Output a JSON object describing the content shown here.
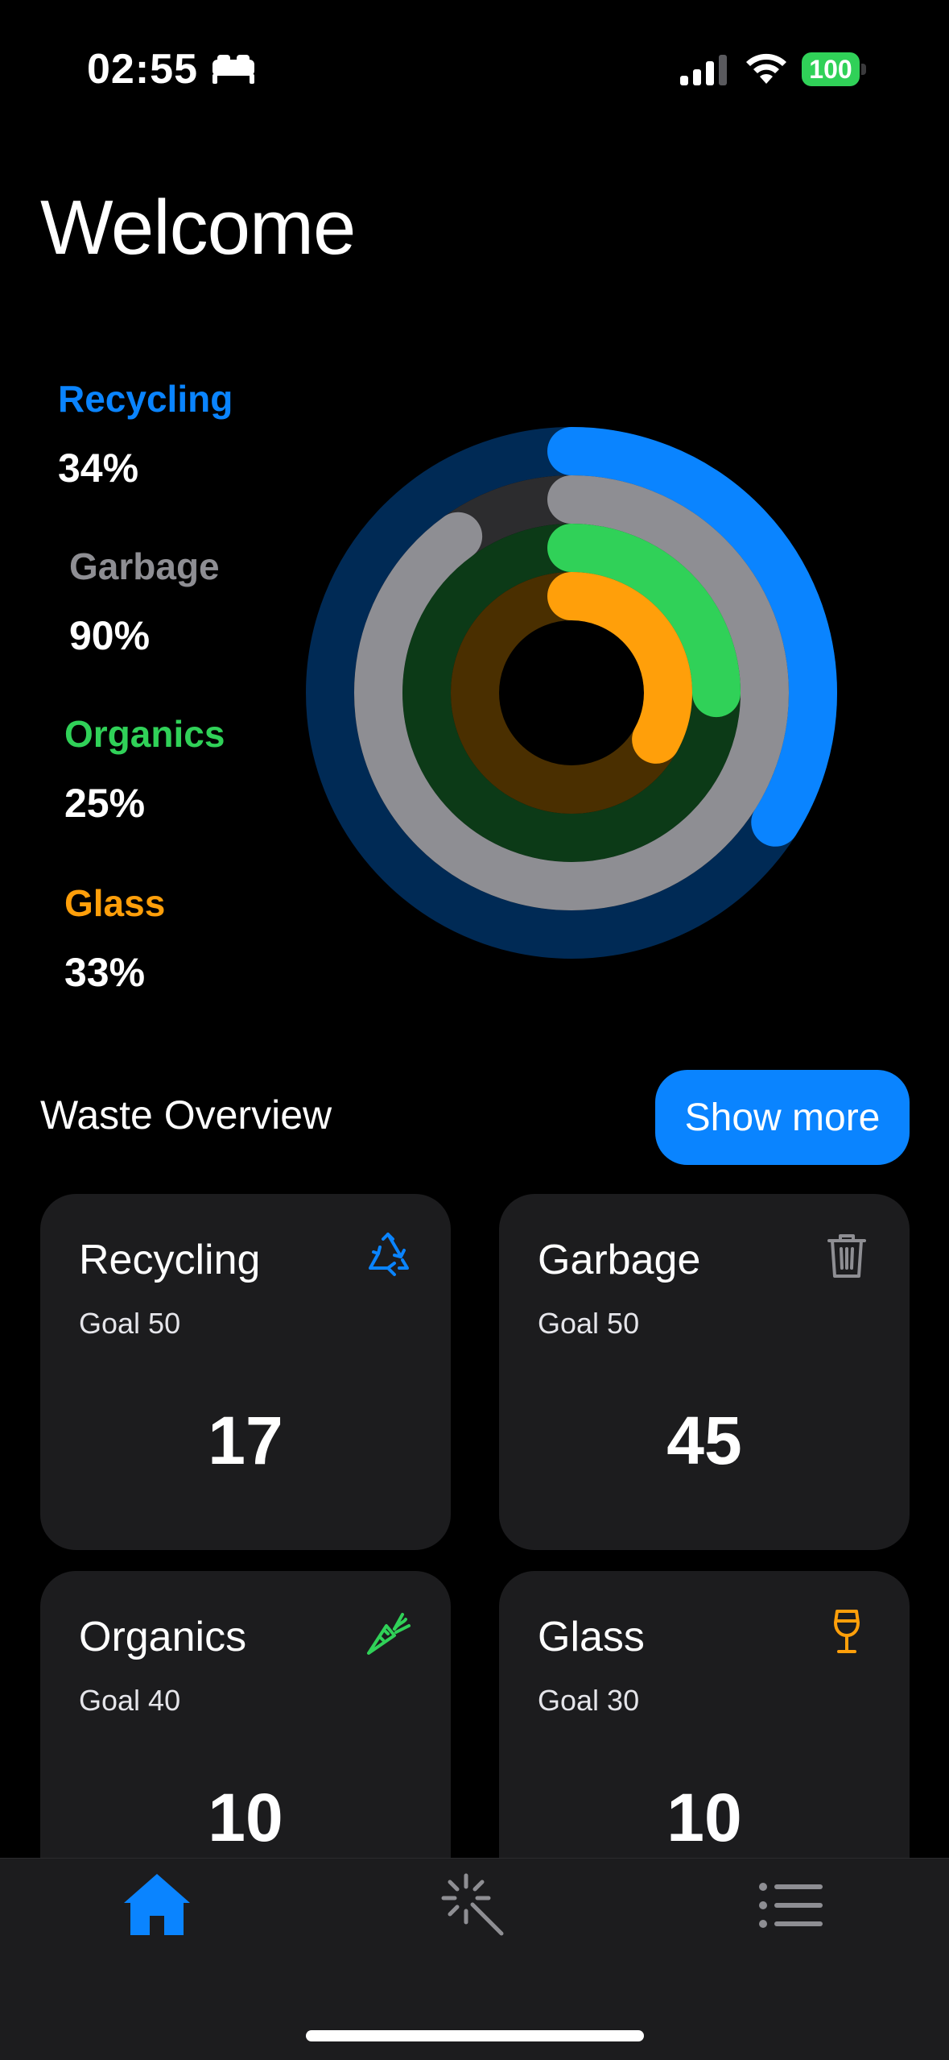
{
  "status_bar": {
    "time": "02:55",
    "battery": "100"
  },
  "page": {
    "title": "Welcome"
  },
  "legend": [
    {
      "label": "Recycling",
      "value": "34%",
      "color": "#0a84ff"
    },
    {
      "label": "Garbage",
      "value": "90%",
      "color": "#8e8e93"
    },
    {
      "label": "Organics",
      "value": "25%",
      "color": "#30d158"
    },
    {
      "label": "Glass",
      "value": "33%",
      "color": "#ff9f0a"
    }
  ],
  "section": {
    "title": "Waste Overview",
    "show_more": "Show more"
  },
  "cards": [
    {
      "title": "Recycling",
      "goal": "Goal 50",
      "value": "17",
      "icon": "recycle-icon",
      "color": "#0a84ff"
    },
    {
      "title": "Garbage",
      "goal": "Goal 50",
      "value": "45",
      "icon": "trash-icon",
      "color": "#8e8e93"
    },
    {
      "title": "Organics",
      "goal": "Goal 40",
      "value": "10",
      "icon": "carrot-icon",
      "color": "#30d158"
    },
    {
      "title": "Glass",
      "goal": "Goal 30",
      "value": "10",
      "icon": "wine-glass-icon",
      "color": "#ff9f0a"
    }
  ],
  "tabs": [
    {
      "name": "home",
      "icon": "house-icon",
      "active": true
    },
    {
      "name": "magic",
      "icon": "magic-wand-icon",
      "active": false
    },
    {
      "name": "list",
      "icon": "list-icon",
      "active": false
    }
  ]
}
